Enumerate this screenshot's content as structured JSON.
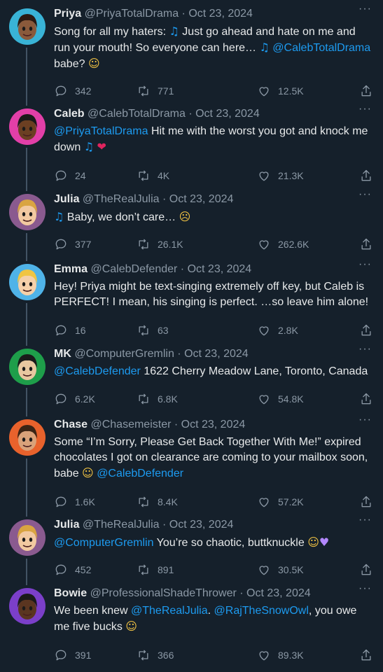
{
  "tweets": [
    {
      "name": "Priya",
      "handle": "@PriyaTotalDrama",
      "date": "Oct 23, 2024",
      "segments": [
        {
          "t": "text",
          "v": "Song for all my haters: "
        },
        {
          "t": "note",
          "v": "♫"
        },
        {
          "t": "text",
          "v": " Just go ahead and hate on me and run your mouth! So everyone can here… "
        },
        {
          "t": "note",
          "v": "♫"
        },
        {
          "t": "text",
          "v": " "
        },
        {
          "t": "mention",
          "v": "@CalebTotalDrama"
        },
        {
          "t": "text",
          "v": " babe? "
        },
        {
          "t": "face",
          "v": "☺"
        }
      ],
      "replies": "342",
      "retweets": "771",
      "likes": "12.5K",
      "avatar_bg": "#39b3d6",
      "skin": "#8a5a3b",
      "hair": "#2b1a12"
    },
    {
      "name": "Caleb",
      "handle": "@CalebTotalDrama",
      "date": "Oct 23, 2024",
      "segments": [
        {
          "t": "mention",
          "v": "@PriyaTotalDrama"
        },
        {
          "t": "text",
          "v": " Hit me with the worst you got and knock me down "
        },
        {
          "t": "note",
          "v": "♫"
        },
        {
          "t": "text",
          "v": " "
        },
        {
          "t": "heart",
          "v": "❤"
        }
      ],
      "replies": "24",
      "retweets": "4K",
      "likes": "21.3K",
      "avatar_bg": "#e23fa8",
      "skin": "#6b3f22",
      "hair": "#1a1a1a"
    },
    {
      "name": "Julia",
      "handle": "@TheRealJulia",
      "date": "Oct 23, 2024",
      "segments": [
        {
          "t": "note",
          "v": "♫"
        },
        {
          "t": "text",
          "v": " Baby, we don’t care… "
        },
        {
          "t": "face",
          "v": "☹"
        }
      ],
      "replies": "377",
      "retweets": "26.1K",
      "likes": "262.6K",
      "avatar_bg": "#8a5a8f",
      "skin": "#f2c9a0",
      "hair": "#d9a441"
    },
    {
      "name": "Emma",
      "handle": "@CalebDefender",
      "date": "Oct 23, 2024",
      "segments": [
        {
          "t": "text",
          "v": "Hey! Priya might be text-singing extremely off key, but Caleb is PERFECT! I mean, his singing is perfect. …so leave him alone!"
        }
      ],
      "replies": "16",
      "retweets": "63",
      "likes": "2.8K",
      "avatar_bg": "#4fb3e8",
      "skin": "#f5d0a9",
      "hair": "#f0c542"
    },
    {
      "name": "MK",
      "handle": "@ComputerGremlin",
      "date": "Oct 23, 2024",
      "segments": [
        {
          "t": "mention",
          "v": "@CalebDefender"
        },
        {
          "t": "text",
          "v": " 1622 Cherry Meadow Lane, Toronto, Canada"
        }
      ],
      "replies": "6.2K",
      "retweets": "6.8K",
      "likes": "54.8K",
      "avatar_bg": "#1e9e4a",
      "skin": "#e8c7a0",
      "hair": "#1a1a1a"
    },
    {
      "name": "Chase",
      "handle": "@Chasemeister",
      "date": "Oct 23, 2024",
      "segments": [
        {
          "t": "text",
          "v": "Some “I’m Sorry, Please Get Back Together With Me!” expired chocolates I got on clearance are coming to your mailbox soon, babe "
        },
        {
          "t": "face",
          "v": "☺"
        },
        {
          "t": "text",
          "v": " "
        },
        {
          "t": "mention",
          "v": "@CalebDefender"
        }
      ],
      "replies": "1.6K",
      "retweets": "8.4K",
      "likes": "57.2K",
      "avatar_bg": "#e8622c",
      "skin": "#d9a27a",
      "hair": "#3b2415"
    },
    {
      "name": "Julia",
      "handle": "@TheRealJulia",
      "date": "Oct 23, 2024",
      "segments": [
        {
          "t": "mention",
          "v": "@ComputerGremlin"
        },
        {
          "t": "text",
          "v": " You’re so chaotic, buttknuckle "
        },
        {
          "t": "face",
          "v": "☺"
        },
        {
          "t": "purple",
          "v": "♥"
        }
      ],
      "replies": "452",
      "retweets": "891",
      "likes": "30.5K",
      "avatar_bg": "#8a5a8f",
      "skin": "#f2c9a0",
      "hair": "#d9a441"
    },
    {
      "name": "Bowie",
      "handle": "@ProfessionalShadeThrower",
      "date": "Oct 23, 2024",
      "segments": [
        {
          "t": "text",
          "v": " We been knew "
        },
        {
          "t": "mention",
          "v": "@TheRealJulia"
        },
        {
          "t": "text",
          "v": ". "
        },
        {
          "t": "mention",
          "v": "@RajTheSnowOwl"
        },
        {
          "t": "text",
          "v": ", you owe me five bucks "
        },
        {
          "t": "face",
          "v": "☺"
        }
      ],
      "replies": "391",
      "retweets": "366",
      "likes": "89.3K",
      "avatar_bg": "#7b3fc9",
      "skin": "#5a3520",
      "hair": "#1a1a1a"
    }
  ],
  "icons": {
    "reply": "reply-icon",
    "retweet": "retweet-icon",
    "like": "like-icon",
    "share": "share-icon",
    "more": "more-icon"
  },
  "colors": {
    "background": "#15202b",
    "mention": "#1d9bf0",
    "muted": "#8b98a5",
    "thread": "#425364"
  },
  "more_label": "···",
  "separator": " · "
}
